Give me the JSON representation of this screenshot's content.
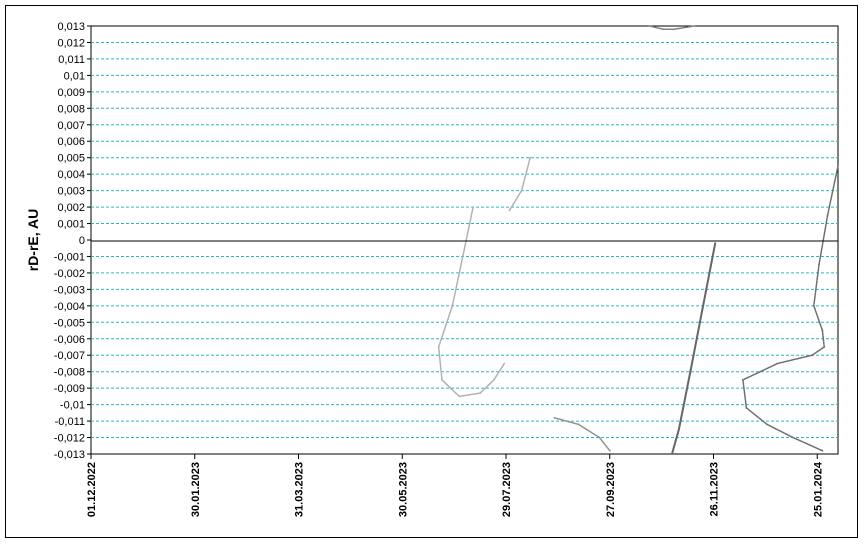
{
  "chart_data": {
    "type": "scatter",
    "title": "",
    "xlabel": "",
    "ylabel": "rD-rE, AU",
    "xlim": [
      "01.12.2022",
      "06.02.2024"
    ],
    "ylim": [
      -0.013,
      0.013
    ],
    "y_ticks": [
      "0,013",
      "0,012",
      "0,011",
      "0,01",
      "0,009",
      "0,008",
      "0,007",
      "0,006",
      "0,005",
      "0,004",
      "0,003",
      "0,002",
      "0,001",
      "0",
      "-0,001",
      "-0,002",
      "-0,003",
      "-0,004",
      "-0,005",
      "-0,006",
      "-0,007",
      "-0,008",
      "-0,009",
      "-0,01",
      "-0,011",
      "-0,012",
      "-0,013"
    ],
    "x_ticks": [
      "01.12.2022",
      "30.01.2023",
      "31.03.2023",
      "30.05.2023",
      "29.07.2023",
      "27.09.2023",
      "26.11.2023",
      "25.01.2024"
    ],
    "grid": "horizontal dashed",
    "series": [
      {
        "color": "#b0b0b0",
        "points": [
          [
            "2023-07-10",
            0.002
          ],
          [
            "2023-07-04",
            -0.001
          ],
          [
            "2023-06-28",
            -0.004
          ],
          [
            "2023-06-20",
            -0.0065
          ],
          [
            "2023-06-22",
            -0.0085
          ],
          [
            "2023-07-02",
            -0.0095
          ],
          [
            "2023-07-14",
            -0.0093
          ],
          [
            "2023-07-22",
            -0.0085
          ],
          [
            "2023-07-28",
            -0.0075
          ]
        ]
      },
      {
        "color": "#b0b0b0",
        "points": [
          [
            "2023-07-31",
            0.0018
          ],
          [
            "2023-08-07",
            0.003
          ],
          [
            "2023-08-12",
            0.005
          ]
        ]
      },
      {
        "color": "#808080",
        "points": [
          [
            "2023-10-20",
            0.013
          ],
          [
            "2023-10-28",
            0.0128
          ],
          [
            "2023-11-03",
            0.0128
          ],
          [
            "2023-11-15",
            0.013
          ]
        ]
      },
      {
        "color": "#909090",
        "points": [
          [
            "2023-08-26",
            -0.0108
          ],
          [
            "2023-09-09",
            -0.0112
          ],
          [
            "2023-09-21",
            -0.012
          ],
          [
            "2023-09-27",
            -0.0128
          ]
        ]
      },
      {
        "color": "#666666",
        "points": [
          [
            "2023-11-27",
            -0.0002
          ],
          [
            "2023-11-20",
            -0.004
          ],
          [
            "2023-11-13",
            -0.0078
          ],
          [
            "2023-11-06",
            -0.0115
          ],
          [
            "2023-11-02",
            -0.013
          ]
        ]
      },
      {
        "color": "#6e6e6e",
        "points": [
          [
            "2024-02-06",
            0.0045
          ],
          [
            "2024-01-31",
            0.0015
          ],
          [
            "2024-01-26",
            -0.0015
          ],
          [
            "2024-01-23",
            -0.004
          ],
          [
            "2024-01-28",
            -0.0055
          ],
          [
            "2024-01-29",
            -0.0065
          ],
          [
            "2024-01-22",
            -0.007
          ],
          [
            "2024-01-02",
            -0.0075
          ],
          [
            "2023-12-13",
            -0.0085
          ],
          [
            "2023-12-15",
            -0.0102
          ],
          [
            "2023-12-27",
            -0.0112
          ],
          [
            "2024-01-11",
            -0.012
          ],
          [
            "2024-01-28",
            -0.0128
          ]
        ]
      }
    ]
  }
}
